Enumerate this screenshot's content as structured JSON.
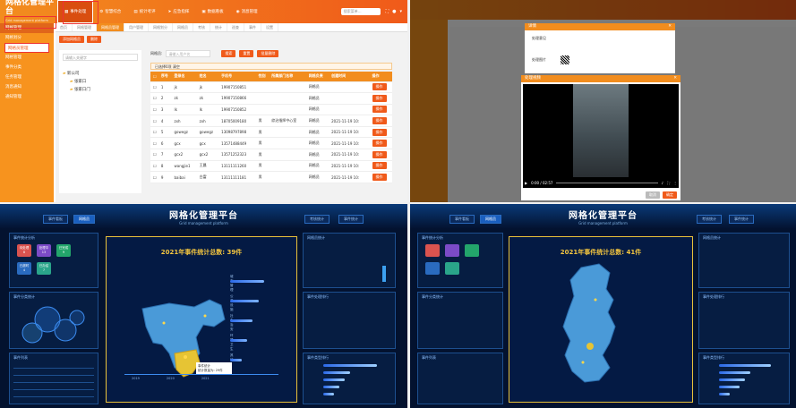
{
  "q1": {
    "brand": "网格化管理平台",
    "brand_sub": "Grid management platform",
    "nav": [
      "事件处理",
      "智慧综合",
      "统计考评",
      "应急指挥",
      "数据看板",
      "消息管理"
    ],
    "search_placeholder": "搜索菜单…",
    "side": [
      "网格管理",
      "网格划分",
      "网格员管理",
      "网格管理",
      "事件分类",
      "任务管理",
      "消息通知",
      "通知管理"
    ],
    "tabs": [
      "首页",
      "网格管理",
      "网格员管理",
      "用户管理",
      "网格划分",
      "网格员",
      "考核",
      "统计",
      "巡查",
      "事件",
      "设置"
    ],
    "btn_add": "添加网格员",
    "btn_del": "删除",
    "filter_label": "网格员:",
    "filter_placeholder": "请输入用户名",
    "btn_search": "搜索",
    "btn_reset": "重置",
    "btn_export": "批量删除",
    "tree_search": "请输入关键字",
    "tree": [
      "新公司",
      "张家口",
      "张家口门"
    ],
    "selected": "已选择0项  清空",
    "cols": [
      "序号",
      "登录名",
      "姓名",
      "手机号",
      "性别",
      "所属部门名称",
      "网格负责",
      "创建时间",
      "操作"
    ],
    "rows": [
      [
        "1",
        "jk",
        "jk",
        "19907150851",
        "",
        "",
        "网格员",
        "",
        "操作"
      ],
      [
        "2",
        "zk",
        "zk",
        "19907150866",
        "",
        "",
        "网格员",
        "",
        "操作"
      ],
      [
        "3",
        "lk",
        "lk",
        "19907150852",
        "",
        "",
        "网格员",
        "",
        "操作"
      ],
      [
        "4",
        "zxh",
        "zxh",
        "18705009180",
        "男",
        "综治指挥中心室",
        "网格员",
        "2021-11-19 10:",
        "操作"
      ],
      [
        "5",
        "gowegz",
        "gowegz",
        "13098797898",
        "男",
        "",
        "网格员",
        "2021-11-19 10:",
        "操作"
      ],
      [
        "6",
        "gcx",
        "gcx",
        "13571488449",
        "男",
        "",
        "网格员",
        "2021-11-19 10:",
        "操作"
      ],
      [
        "7",
        "gcx2",
        "gcx2",
        "13571252323",
        "男",
        "",
        "网格员",
        "2021-11-19 10:",
        "操作"
      ],
      [
        "8",
        "wangjie1",
        "王晨",
        "13111111260",
        "男",
        "",
        "网格员",
        "2021-11-19 10:",
        "操作"
      ],
      [
        "9",
        "baibai",
        "白富",
        "13111111181",
        "男",
        "",
        "网格员",
        "2021-11-19 10:",
        "操作"
      ]
    ]
  },
  "q2": {
    "dialog_title": "详情",
    "field1": "处理意见",
    "field2": "处理图片",
    "video_title": "处理视频",
    "video_time": "0:00 / 02:57",
    "btn_cancel": "取消",
    "btn_ok": "确定",
    "progress": 0.0
  },
  "q3": {
    "title": "网格化管理平台",
    "subtitle": "Grid management platform",
    "btn1": "事件看板",
    "btn2": "网格员",
    "btn3": "考核统计",
    "btn4": "事件统计",
    "map_title": "2021年事件统计总数: 39件",
    "tooltip": "事件统计\n统计数量为: 29件",
    "tiles": [
      [
        "待处理",
        "8",
        "#d9534f"
      ],
      [
        "处理中",
        "13",
        "#7b4bc7"
      ],
      [
        "已完成",
        "9",
        "#23a56b"
      ],
      [
        "已超时",
        "4",
        "#2a6bbf"
      ],
      [
        "已办结",
        "7",
        "#2aa58a"
      ]
    ],
    "sec_left1": "事件统计分析",
    "sec_left2": "事件分类统计",
    "sec_left3": "事件列表",
    "sec_right1": "网格员统计",
    "sec_right2": "事件处理排行",
    "sec_right3": "事件类型排行",
    "bars": [
      "城市管理",
      "公共设施",
      "社会治安",
      "环境卫生",
      "其他"
    ],
    "bar_values": [
      6,
      5,
      4,
      3,
      2
    ],
    "years": [
      "2019",
      "2020",
      "2021"
    ],
    "rank_values": [
      100.0,
      50.0,
      40.0,
      30.0,
      20.0
    ]
  },
  "q4": {
    "map_title": "2021年事件统计总数: 41件",
    "rank_values": [
      100.0,
      60.0,
      50.0,
      40.0,
      20.0
    ]
  },
  "colors": {
    "orange": "#f28d1e",
    "dark": "#03122f",
    "gold": "#e9c23a"
  }
}
